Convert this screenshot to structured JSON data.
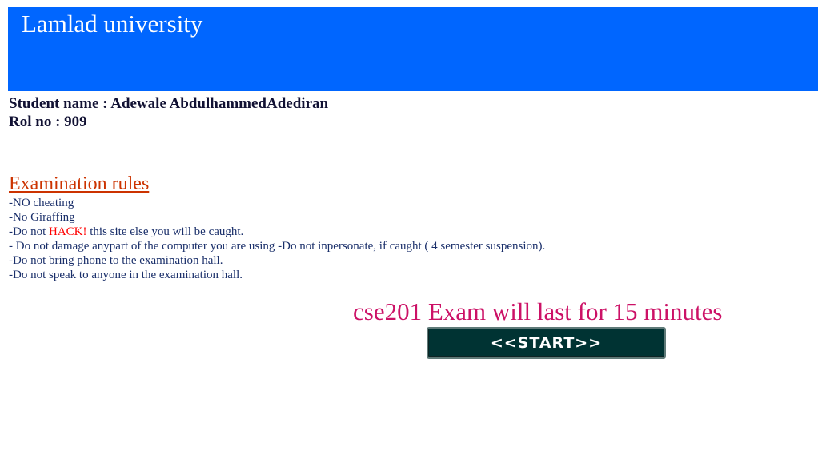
{
  "header": {
    "title": "Lamlad university",
    "background_color": "#0066ff"
  },
  "student": {
    "name_label": "Student name : ",
    "name_value": "Adewale AbdulhammedAdediran",
    "roll_label": "Rol no : ",
    "roll_value": "909"
  },
  "rules": {
    "heading": "Examination rules",
    "items": [
      "-NO cheating",
      "-No Giraffing",
      {
        "prefix": "-Do not ",
        "highlight": "HACK!",
        "suffix": " this site else you will be caught."
      },
      "- Do not damage anypart of the computer you are using -Do not inpersonate, if caught ( 4 semester suspension).",
      "-Do not bring phone to the examination hall.",
      "-Do not speak to anyone in the examination hall."
    ]
  },
  "exam": {
    "notice": "cse201 Exam will last for 15 minutes",
    "start_label": "<<START>>"
  },
  "colors": {
    "rules_heading": "#cc3300",
    "highlight": "#ff0000",
    "notice": "#cc1166",
    "button_bg": "#003333"
  }
}
